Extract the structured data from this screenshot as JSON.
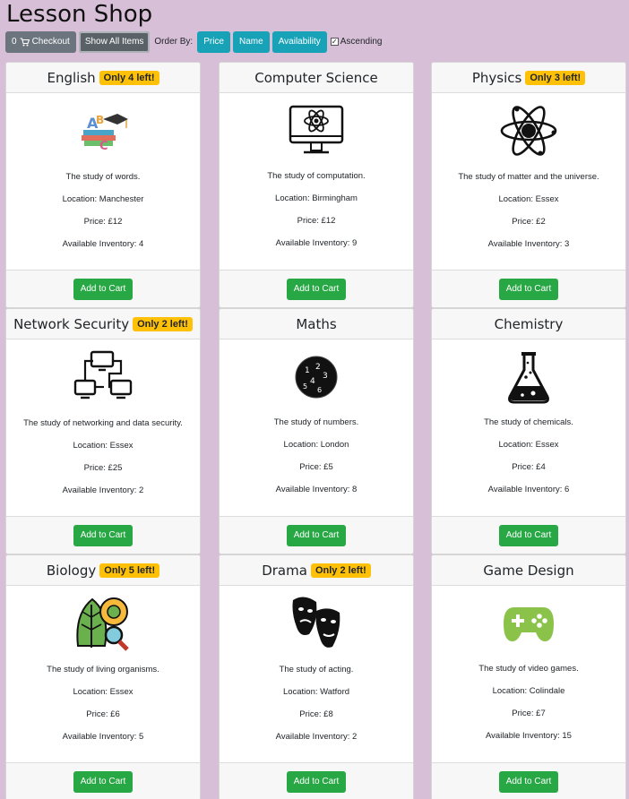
{
  "page": {
    "title": "Lesson Shop"
  },
  "toolbar": {
    "checkout_count": "0",
    "checkout_label": "Checkout",
    "show_all_label": "Show All Items",
    "order_by_label": "Order By:",
    "sort_price": "Price",
    "sort_name": "Name",
    "sort_availability": "Availability",
    "ascending_label": "Ascending",
    "ascending_checked": "✓"
  },
  "cards": [
    {
      "name": "English",
      "badge": "Only 4 left!",
      "icon": "alphabet-books-icon",
      "description": "The study of words.",
      "location": "Location: Manchester",
      "price": "Price: £12",
      "inventory": "Available Inventory: 4",
      "button": "Add to Cart"
    },
    {
      "name": "Computer Science",
      "badge": "",
      "icon": "monitor-atom-icon",
      "description": "The study of computation.",
      "location": "Location: Birmingham",
      "price": "Price: £12",
      "inventory": "Available Inventory: 9",
      "button": "Add to Cart"
    },
    {
      "name": "Physics",
      "badge": "Only 3 left!",
      "icon": "atom-icon",
      "description": "The study of matter and the universe.",
      "location": "Location: Essex",
      "price": "Price: £2",
      "inventory": "Available Inventory: 3",
      "button": "Add to Cart"
    },
    {
      "name": "Network Security",
      "badge": "Only 2 left!",
      "icon": "network-computers-icon",
      "description": "The study of networking and data security.",
      "location": "Location: Essex",
      "price": "Price: £25",
      "inventory": "Available Inventory: 2",
      "button": "Add to Cart"
    },
    {
      "name": "Maths",
      "badge": "",
      "icon": "numbers-circle-icon",
      "description": "The study of numbers.",
      "location": "Location: London",
      "price": "Price: £5",
      "inventory": "Available Inventory: 8",
      "button": "Add to Cart"
    },
    {
      "name": "Chemistry",
      "badge": "",
      "icon": "flask-icon",
      "description": "The study of chemicals.",
      "location": "Location: Essex",
      "price": "Price: £4",
      "inventory": "Available Inventory: 6",
      "button": "Add to Cart"
    },
    {
      "name": "Biology",
      "badge": "Only 5 left!",
      "icon": "leaf-microscope-icon",
      "description": "The study of living organisms.",
      "location": "Location: Essex",
      "price": "Price: £6",
      "inventory": "Available Inventory: 5",
      "button": "Add to Cart"
    },
    {
      "name": "Drama",
      "badge": "Only 2 left!",
      "icon": "theatre-masks-icon",
      "description": "The study of acting.",
      "location": "Location: Watford",
      "price": "Price: £8",
      "inventory": "Available Inventory: 2",
      "button": "Add to Cart"
    },
    {
      "name": "Game Design",
      "badge": "",
      "icon": "gamepad-icon",
      "description": "The study of video games.",
      "location": "Location: Colindale",
      "price": "Price: £7",
      "inventory": "Available Inventory: 15",
      "button": "Add to Cart"
    }
  ],
  "colors": {
    "background": "#d8bfd8",
    "badge": "#ffc107",
    "add_button": "#28a745",
    "sort_button": "#17a2b8",
    "nav_button": "#6c757d"
  }
}
